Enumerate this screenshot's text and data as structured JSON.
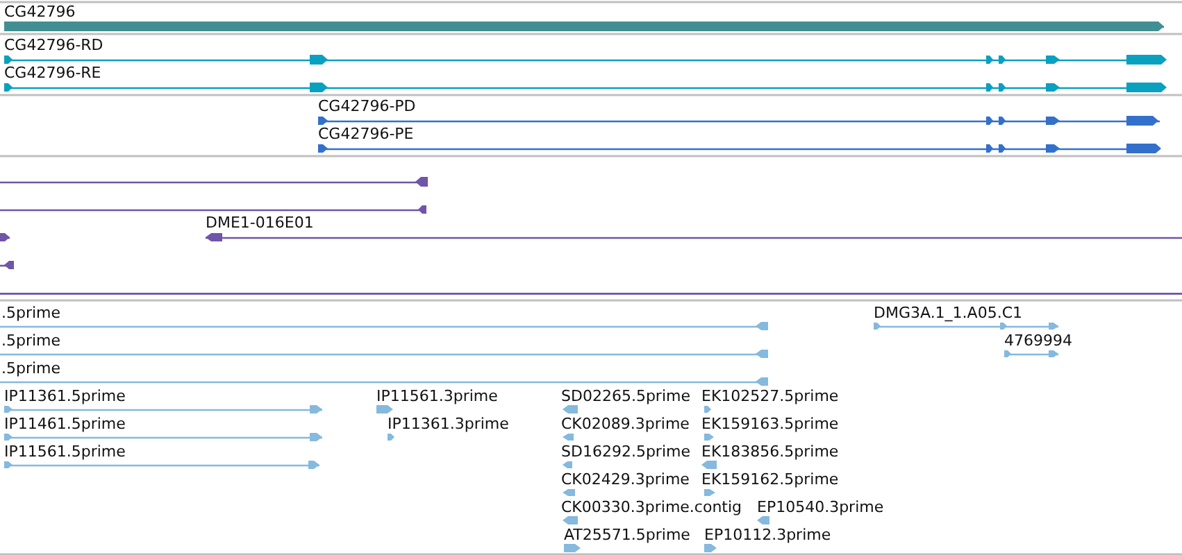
{
  "tracks": [
    {
      "color": "#418f92",
      "features": [
        {
          "label": "CG42796",
          "reverse": false
        }
      ]
    },
    {
      "color": "#0aa0c0",
      "features": [
        {
          "label": "CG42796-RD",
          "reverse": false
        },
        {
          "label": "CG42796-RE",
          "reverse": false
        }
      ]
    },
    {
      "color": "#3370cc",
      "features": [
        {
          "label": "CG42796-PD",
          "reverse": false
        },
        {
          "label": "CG42796-PE",
          "reverse": false
        }
      ]
    },
    {
      "color": "#7055a8",
      "spanning_line": true,
      "features": [
        {
          "reverse": true
        },
        {
          "reverse": true
        },
        {
          "label": "DME1-016E01",
          "reverse": true
        },
        {
          "reverse": false
        },
        {
          "reverse": true
        }
      ]
    },
    {
      "color": "#85b9dd",
      "features": [
        {
          "label": ".5prime",
          "reverse": true
        },
        {
          "label": "DMG3A.1_1.A05.C1",
          "reverse": false
        },
        {
          "label": ".5prime",
          "reverse": true
        },
        {
          "label": "4769994",
          "reverse": false
        },
        {
          "label": ".5prime",
          "reverse": true
        },
        {
          "label": "IP11361.5prime",
          "reverse": false
        },
        {
          "label": "IP11561.3prime",
          "reverse": false
        },
        {
          "label": "SD02265.5prime",
          "reverse": true
        },
        {
          "label": "EK102527.5prime",
          "reverse": false
        },
        {
          "label": "IP11461.5prime",
          "reverse": false
        },
        {
          "label": "IP11361.3prime",
          "reverse": false
        },
        {
          "label": "CK02089.3prime",
          "reverse": true
        },
        {
          "label": "EK159163.5prime",
          "reverse": false
        },
        {
          "label": "IP11561.5prime",
          "reverse": false
        },
        {
          "label": "SD16292.5prime",
          "reverse": true
        },
        {
          "label": "EK183856.5prime",
          "reverse": true
        },
        {
          "label": "CK02429.3prime",
          "reverse": true
        },
        {
          "label": "EK159162.5prime",
          "reverse": false
        },
        {
          "label": "CK00330.3prime.contig",
          "reverse": true
        },
        {
          "label": "EP10540.3prime",
          "reverse": true
        },
        {
          "label": "AT25571.5prime",
          "reverse": false
        },
        {
          "label": "EP10112.3prime",
          "reverse": false
        }
      ]
    }
  ]
}
